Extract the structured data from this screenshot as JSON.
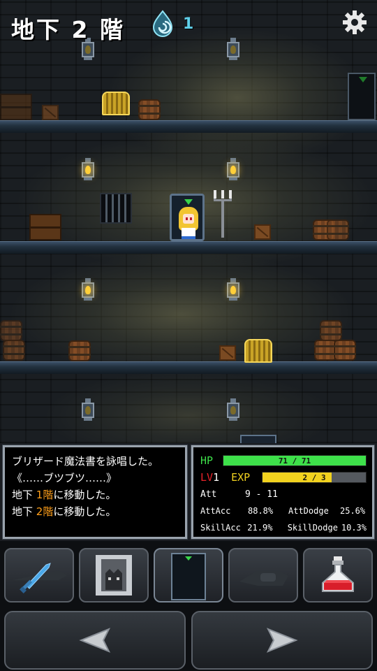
{
  "hud": {
    "floor_title": "地下 2 階",
    "soul_count": "1"
  },
  "icons": [
    "soul-icon",
    "gear-icon",
    "sword-icon",
    "monster-icon",
    "door-icon",
    "gauntlet-icon",
    "potion-icon",
    "arrow-left-icon",
    "arrow-right-icon"
  ],
  "log": {
    "lines": [
      {
        "prefix": "ブリザード",
        "highlight": "",
        "text": "魔法書を詠唱した。"
      },
      {
        "prefix": "《……ブツブツ……》",
        "highlight": "",
        "text": ""
      },
      {
        "prefix": "地下 ",
        "highlight": "1階",
        "text": "に移動した。"
      },
      {
        "prefix": "地下 ",
        "highlight": "2階",
        "text": "に移動した。"
      }
    ]
  },
  "stats": {
    "hp_label": "HP",
    "hp_current": 71,
    "hp_max": 71,
    "hp_text": "71 / 71",
    "lv_label": "LV",
    "lv_value": "1",
    "exp_label": "EXP",
    "exp_text": "2 / 3",
    "exp_fraction": 0.67,
    "att_label": "Att",
    "att_value": "9 - 11",
    "attacc_label": "AttAcc",
    "attacc_value": "88.8%",
    "attdodge_label": "AttDodge",
    "attdodge_value": "25.6%",
    "skillacc_label": "SkillAcc",
    "skillacc_value": "21.9%",
    "skilldodge_label": "SkillDodge",
    "skilldodge_value": "10.3%"
  },
  "colors": {
    "hp_bar": "#3ee04a",
    "exp_bar": "#f2d21f",
    "lv_label": "#e8232a",
    "log_highlight": "#ff9f1a",
    "soul": "#5fd0ea"
  }
}
